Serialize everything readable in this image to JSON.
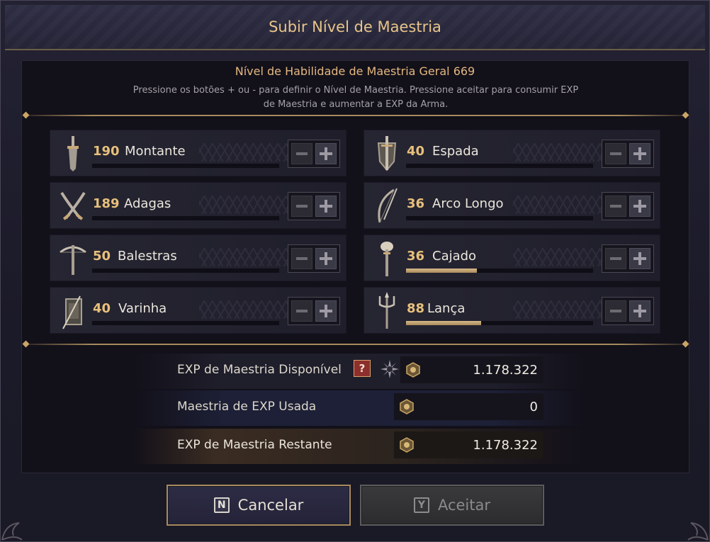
{
  "window": {
    "title": "Subir Nível de Maestria"
  },
  "header": {
    "overall_label": "Nível de Habilidade de Maestria Geral 669",
    "instructions_line1": "Pressione os botões + ou - para definir o Nível de Maestria. Pressione aceitar para consumir EXP",
    "instructions_line2": "de Maestria e aumentar a EXP da Arma."
  },
  "weapons": [
    {
      "level": "190",
      "name": "Montante",
      "icon": "greatsword-icon",
      "progress": 0
    },
    {
      "level": "40",
      "name": "Espada",
      "icon": "sword-and-shield-icon",
      "progress": 0
    },
    {
      "level": "189",
      "name": "Adagas",
      "icon": "daggers-icon",
      "progress": 0
    },
    {
      "level": "36",
      "name": "Arco Longo",
      "icon": "longbow-icon",
      "progress": 0
    },
    {
      "level": "50",
      "name": "Balestras",
      "icon": "crossbow-icon",
      "progress": 0
    },
    {
      "level": "36",
      "name": "Cajado",
      "icon": "staff-icon",
      "progress": 0.38
    },
    {
      "level": "40",
      "name": "Varinha",
      "icon": "wand-tome-icon",
      "progress": 0
    },
    {
      "level": "88",
      "name": "Lança",
      "icon": "spear-icon",
      "progress": 0.4
    }
  ],
  "exp": {
    "available_label": "EXP de Maestria Disponível",
    "available_value": "1.178.322",
    "help_label": "?",
    "used_label": "Maestria de EXP Usada",
    "used_value": "0",
    "remaining_label": "EXP de Maestria Restante",
    "remaining_value": "1.178.322"
  },
  "buttons": {
    "cancel_key": "N",
    "cancel_label": "Cancelar",
    "accept_key": "Y",
    "accept_label": "Aceitar"
  },
  "colors": {
    "accent_gold": "#e8c07c",
    "progress_fill": "#c9ab7a"
  }
}
